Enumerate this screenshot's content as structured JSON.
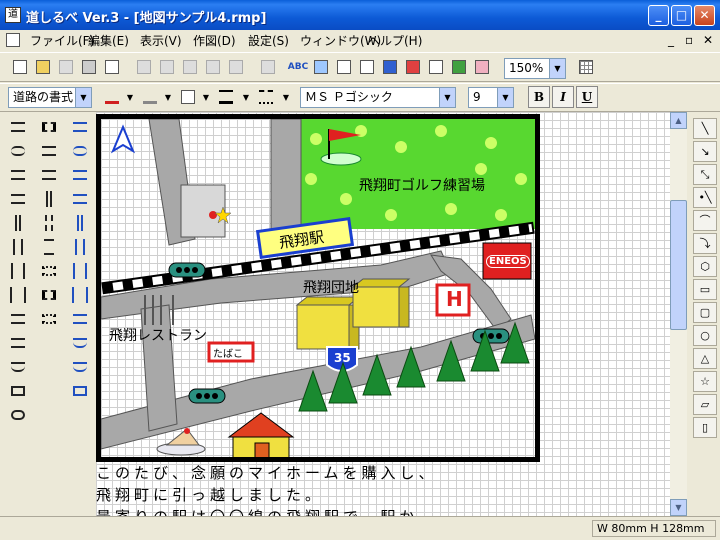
{
  "window": {
    "title": "道しるべ Ver.3 - [地図サンプル4.rmp]",
    "app_icon_glyph": "道"
  },
  "titlebar_buttons": {
    "minimize": "_",
    "maximize": "□",
    "close": "✕"
  },
  "menu": {
    "items": [
      "ファイル(F)",
      "編集(E)",
      "表示(V)",
      "作図(D)",
      "設定(S)",
      "ウィンドウ(W)",
      "ヘルプ(H)"
    ],
    "mdi": {
      "minimize": "_",
      "restore": "▫",
      "close": "✕"
    }
  },
  "toolbar": {
    "zoom_value": "150%",
    "style_value": "道路の書式",
    "font_value": "ＭＳ Ｐゴシック",
    "font_size_value": "9",
    "bold_label": "B",
    "italic_label": "I",
    "underline_label": "U",
    "abc_label": "ABC"
  },
  "map": {
    "labels": {
      "golf": "飛翔町ゴルフ練習場",
      "station": "飛翔駅",
      "danchi": "飛翔団地",
      "restaurant": "飛翔レストラン",
      "tobacco": "たばこ",
      "route_number": "35",
      "gas_station": "ENEOS",
      "honda": "H"
    },
    "colors": {
      "road": "#a8a8a8",
      "golf_green": "#58d830",
      "golf_light": "#ccff66",
      "rail": "#000000",
      "station_sign": "#ffff80",
      "sign_border": "#1a3fd0",
      "eneos_red": "#e02020",
      "route_blue": "#1a3fd0",
      "tree": "#1a8a30",
      "building": "#f0e040"
    }
  },
  "body_text": {
    "line1": "このたび、念願のマイホームを購入し、",
    "line2": "飛翔町に引っ越しました。",
    "line3": "最寄りの駅は〇〇線の飛翔駅で、駅か"
  },
  "status": {
    "size": "W 80mm H 128mm"
  }
}
